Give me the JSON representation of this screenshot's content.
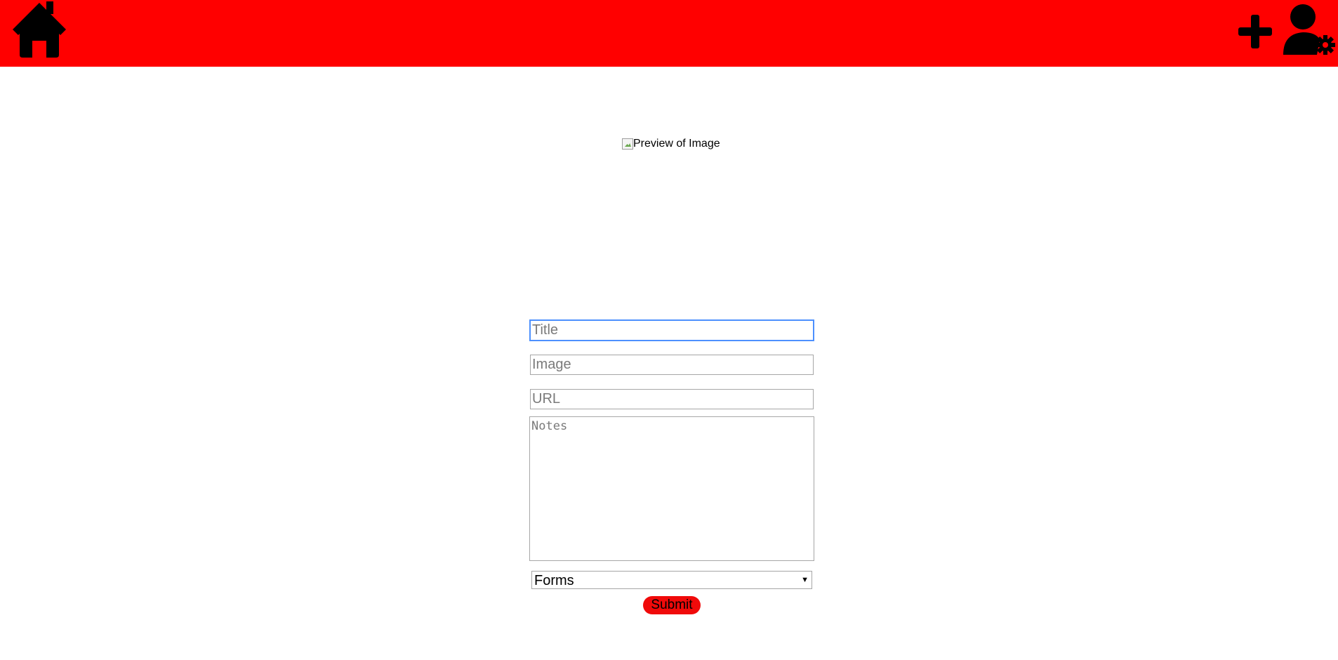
{
  "header": {
    "background_color": "#ff0000",
    "home_icon": "home-icon",
    "add_icon": "plus-icon",
    "user_settings_icon": "user-gear-icon"
  },
  "preview": {
    "alt_text": "Preview of Image"
  },
  "form": {
    "title_placeholder": "Title",
    "image_placeholder": "Image",
    "url_placeholder": "URL",
    "notes_placeholder": "Notes",
    "category_selected": "Forms",
    "submit_label": "Submit",
    "submit_color": "#f00a0a",
    "focus_color": "#4d90fe"
  }
}
